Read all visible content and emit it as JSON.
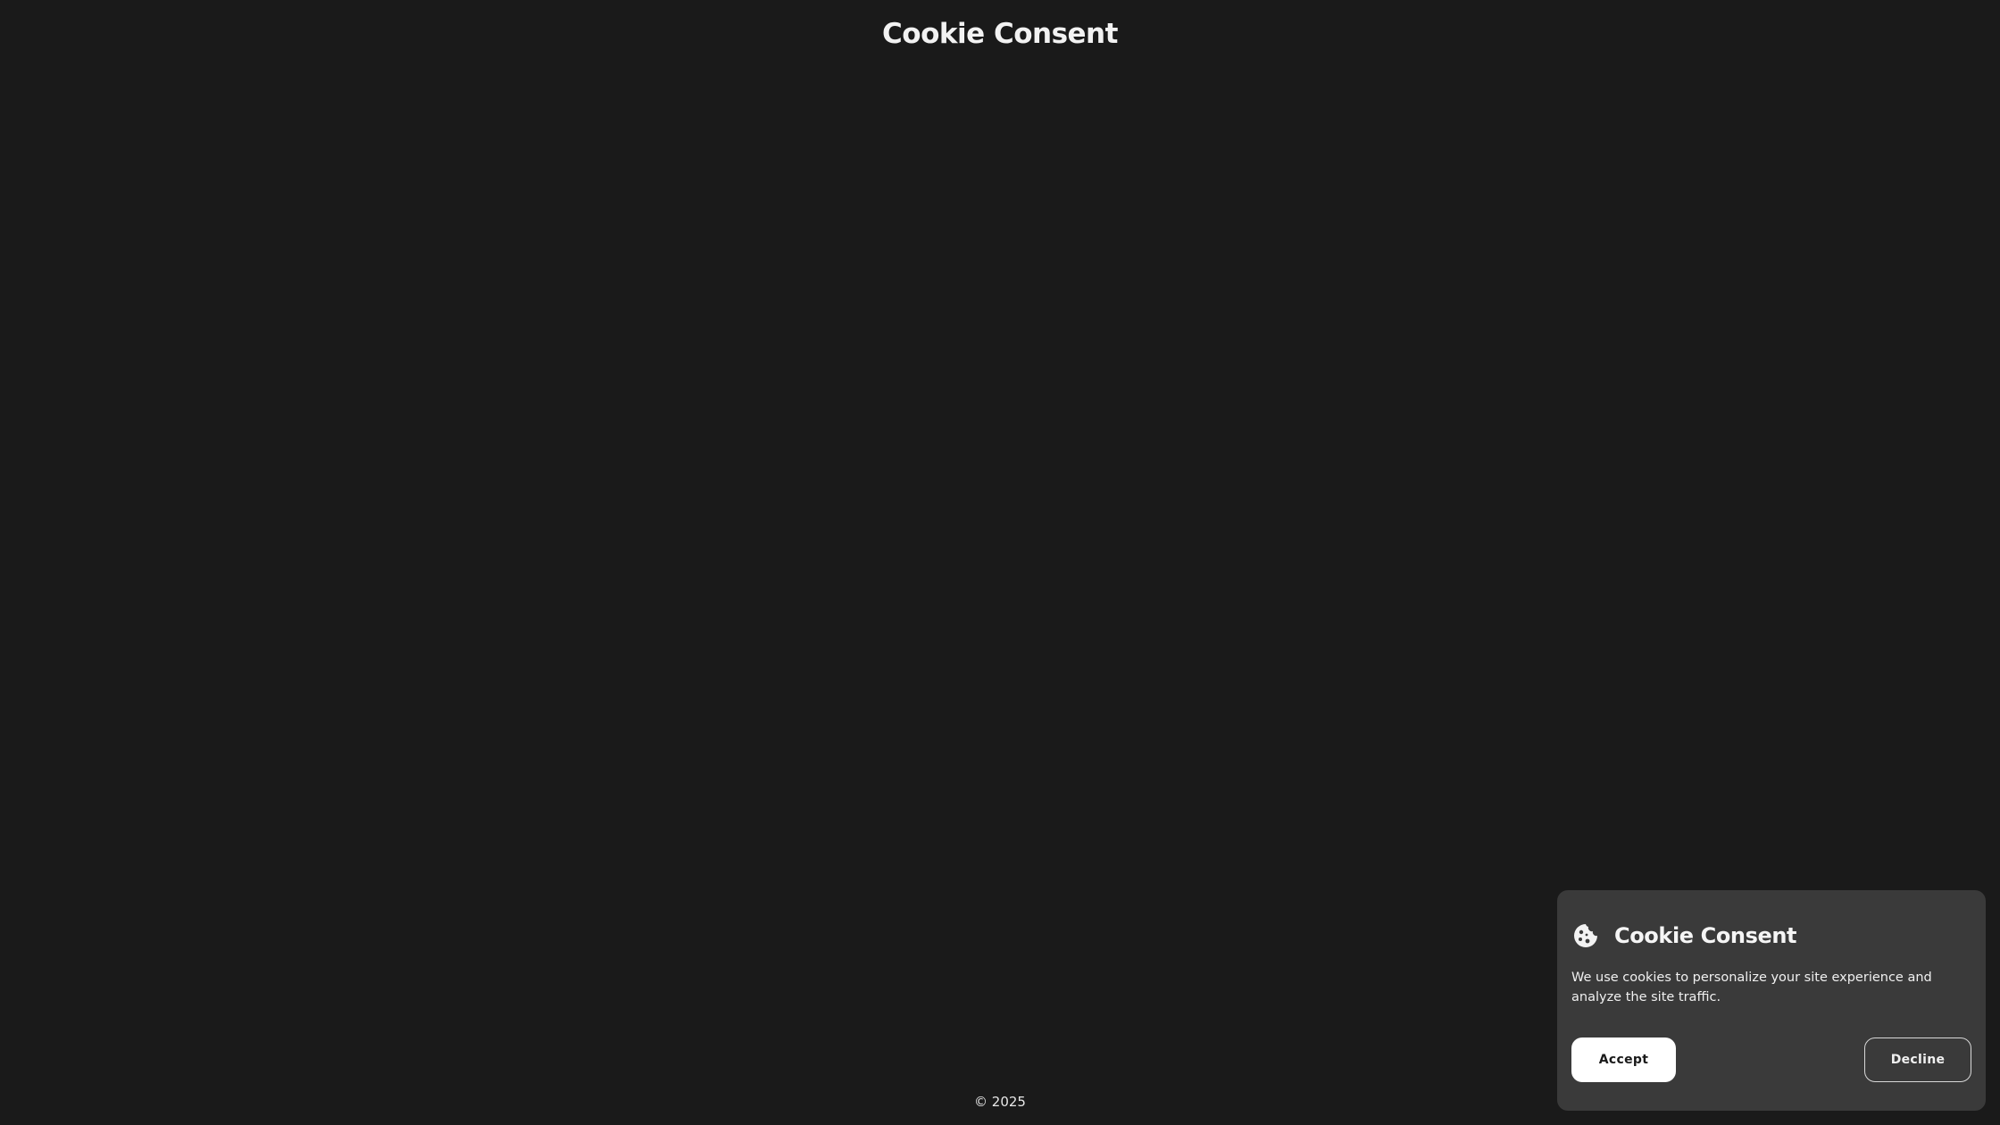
{
  "page": {
    "title": "Cookie Consent",
    "footer": "© 2025"
  },
  "consent": {
    "icon": "cookie-icon",
    "title": "Cookie Consent",
    "message": "We use cookies to personalize your site experience and analyze the site traffic.",
    "accept_label": "Accept",
    "decline_label": "Decline"
  },
  "colors": {
    "background": "#1a1a1a",
    "card": "#3a3a3a",
    "accept_button": "#ffffff",
    "text": "#f2f2f2"
  }
}
